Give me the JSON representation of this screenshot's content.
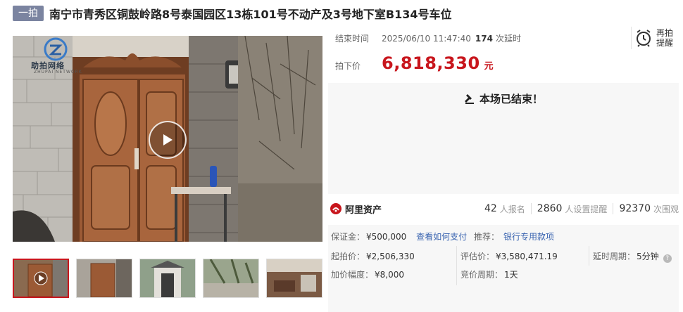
{
  "header": {
    "tag": "一拍",
    "title": "南宁市青秀区铜鼓岭路8号泰国园区13栋101号不动产及3号地下室B134号车位"
  },
  "media": {
    "watermark_text": "助拍网络",
    "watermark_sub": "ZHUPAI NETWORK",
    "thumbnail_count": 5
  },
  "auction": {
    "end_label": "结束时间",
    "end_time": "2025/06/10 11:47:40",
    "delay_count": "174",
    "delay_suffix": "次延时",
    "price_label": "拍下价",
    "price": "6,818,330",
    "price_unit": "元",
    "remind_label": "再拍提醒",
    "ended_text": "本场已结束！"
  },
  "platform": {
    "name": "阿里资产"
  },
  "stats": {
    "signups": "42",
    "signups_label": "人报名",
    "reminders": "2860",
    "reminders_label": "人设置提醒",
    "views": "92370",
    "views_label": "次围观"
  },
  "details": {
    "deposit_label": "保证金：",
    "deposit_value": "¥500,000",
    "how_to_pay": "查看如何支付",
    "recommend_label": "推荐：",
    "recommend_value": "银行专用款项",
    "start_price_label": "起拍价：",
    "start_price_value": "¥2,506,330",
    "eval_price_label": "评估价：",
    "eval_price_value": "¥3,580,471.19",
    "delay_period_label": "延时周期：",
    "delay_period_value": "5分钟",
    "increment_label": "加价幅度：",
    "increment_value": "¥8,000",
    "bid_period_label": "竞价周期：",
    "bid_period_value": "1天"
  },
  "colors": {
    "accent": "#c8161d",
    "link": "#3a64b0",
    "tag_bg": "#7b84a0"
  }
}
